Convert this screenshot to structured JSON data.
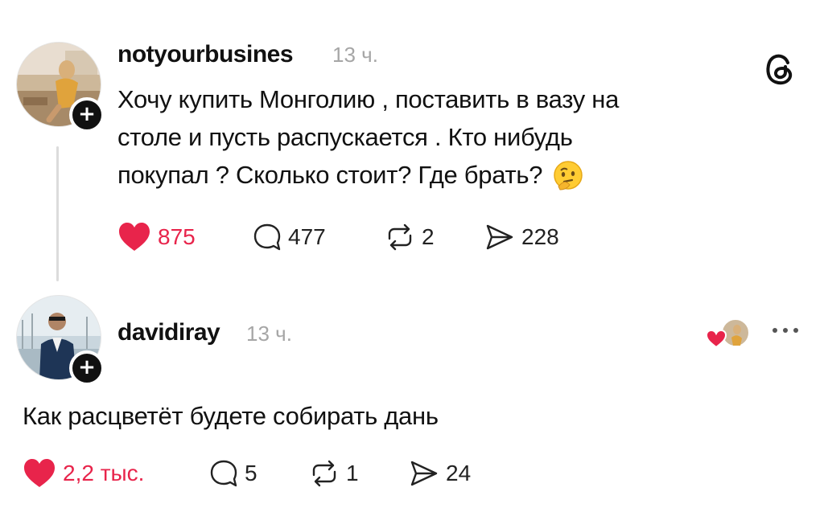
{
  "post": {
    "username": "notyourbusines",
    "time": "13 ч.",
    "text_lines": [
      "Хочу купить Монголию , поставить в вазу на",
      "столе и пусть распускается . Кто нибудь",
      "покупал ? Сколько стоит? Где брать?"
    ],
    "emoji": "thinking-face",
    "likes": "875",
    "comments": "477",
    "reposts": "2",
    "shares": "228",
    "liked": true
  },
  "reply": {
    "username": "davidiray",
    "time": "13 ч.",
    "text": "Как расцветёт будете собирать дань",
    "likes": "2,2 тыс.",
    "comments": "5",
    "reposts": "1",
    "shares": "24",
    "liked": true
  },
  "icons": {
    "app_logo": "threads-logo-icon",
    "like": "heart-icon",
    "comment": "comment-bubble-icon",
    "repost": "repost-icon",
    "share": "send-icon",
    "more": "more-dots-icon",
    "follow": "plus-icon"
  },
  "colors": {
    "like_red": "#e8244b",
    "text": "#111111",
    "muted": "#a6a6a6",
    "thread_line": "#dcdcdc"
  }
}
